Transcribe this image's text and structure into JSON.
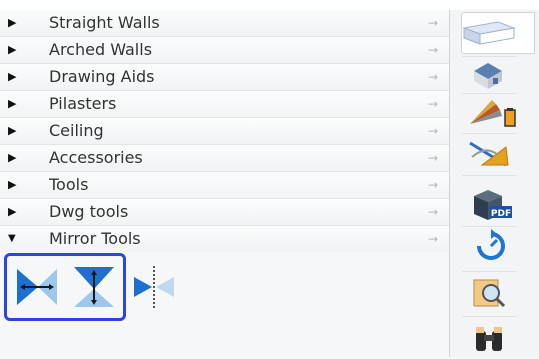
{
  "categories": [
    {
      "label": "Straight Walls",
      "expanded": false
    },
    {
      "label": "Arched Walls",
      "expanded": false
    },
    {
      "label": "Drawing Aids",
      "expanded": false
    },
    {
      "label": "Pilasters",
      "expanded": false
    },
    {
      "label": "Ceiling",
      "expanded": false
    },
    {
      "label": "Accessories",
      "expanded": false
    },
    {
      "label": "Tools",
      "expanded": false
    },
    {
      "label": "Dwg tools",
      "expanded": false
    },
    {
      "label": "Mirror Tools",
      "expanded": true
    }
  ],
  "glyphs": {
    "collapsed": "▶",
    "expanded": "▼",
    "goto": "→"
  },
  "mirror_tools": [
    "mirror-horizontal-icon",
    "mirror-vertical-icon",
    "mirror-axis-icon"
  ],
  "side_icons": [
    "walls-3d-icon",
    "house-icon",
    "materials-icon",
    "drawing-tools-icon",
    "pdf-icon",
    "refresh-icon",
    "inspect-icon",
    "binoculars-icon"
  ],
  "colors": {
    "accent": "#2a44e6",
    "tool_blue": "#1e6fcf",
    "tool_light": "#9fc6ec"
  }
}
